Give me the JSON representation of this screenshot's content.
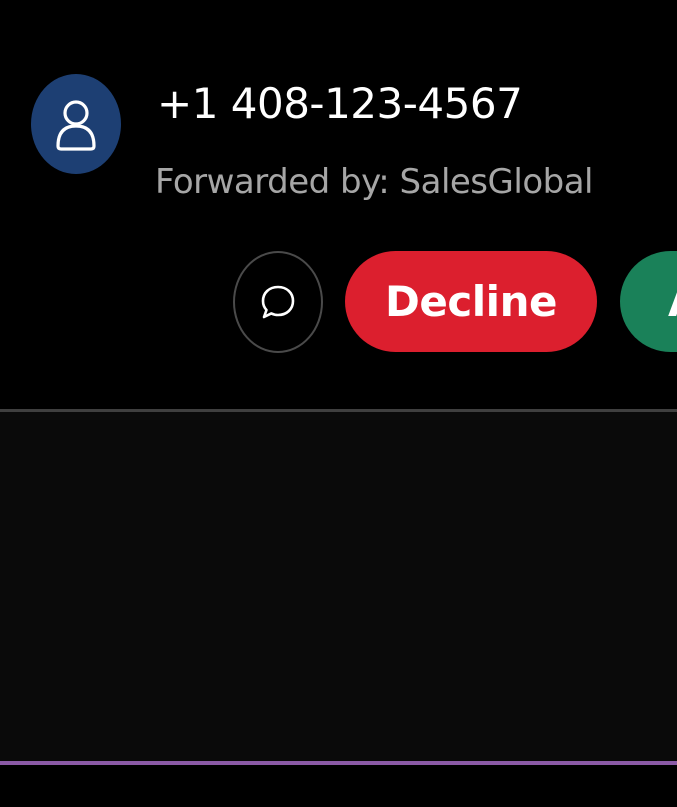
{
  "call": {
    "caller_number": "+1 408-123-4567",
    "forwarded_by": "Forwarded by: SalesGlobal"
  },
  "actions": {
    "message_icon": "chat-bubble-icon",
    "decline_label": "Decline",
    "accept_label": "Accept"
  },
  "icons": {
    "avatar": "person-icon"
  },
  "colors": {
    "avatar_bg": "#1d3f73",
    "decline": "#dc1f2e",
    "accept": "#1a8159",
    "accent_line": "#8b5aa6",
    "secondary_text": "#a6a6a6"
  }
}
